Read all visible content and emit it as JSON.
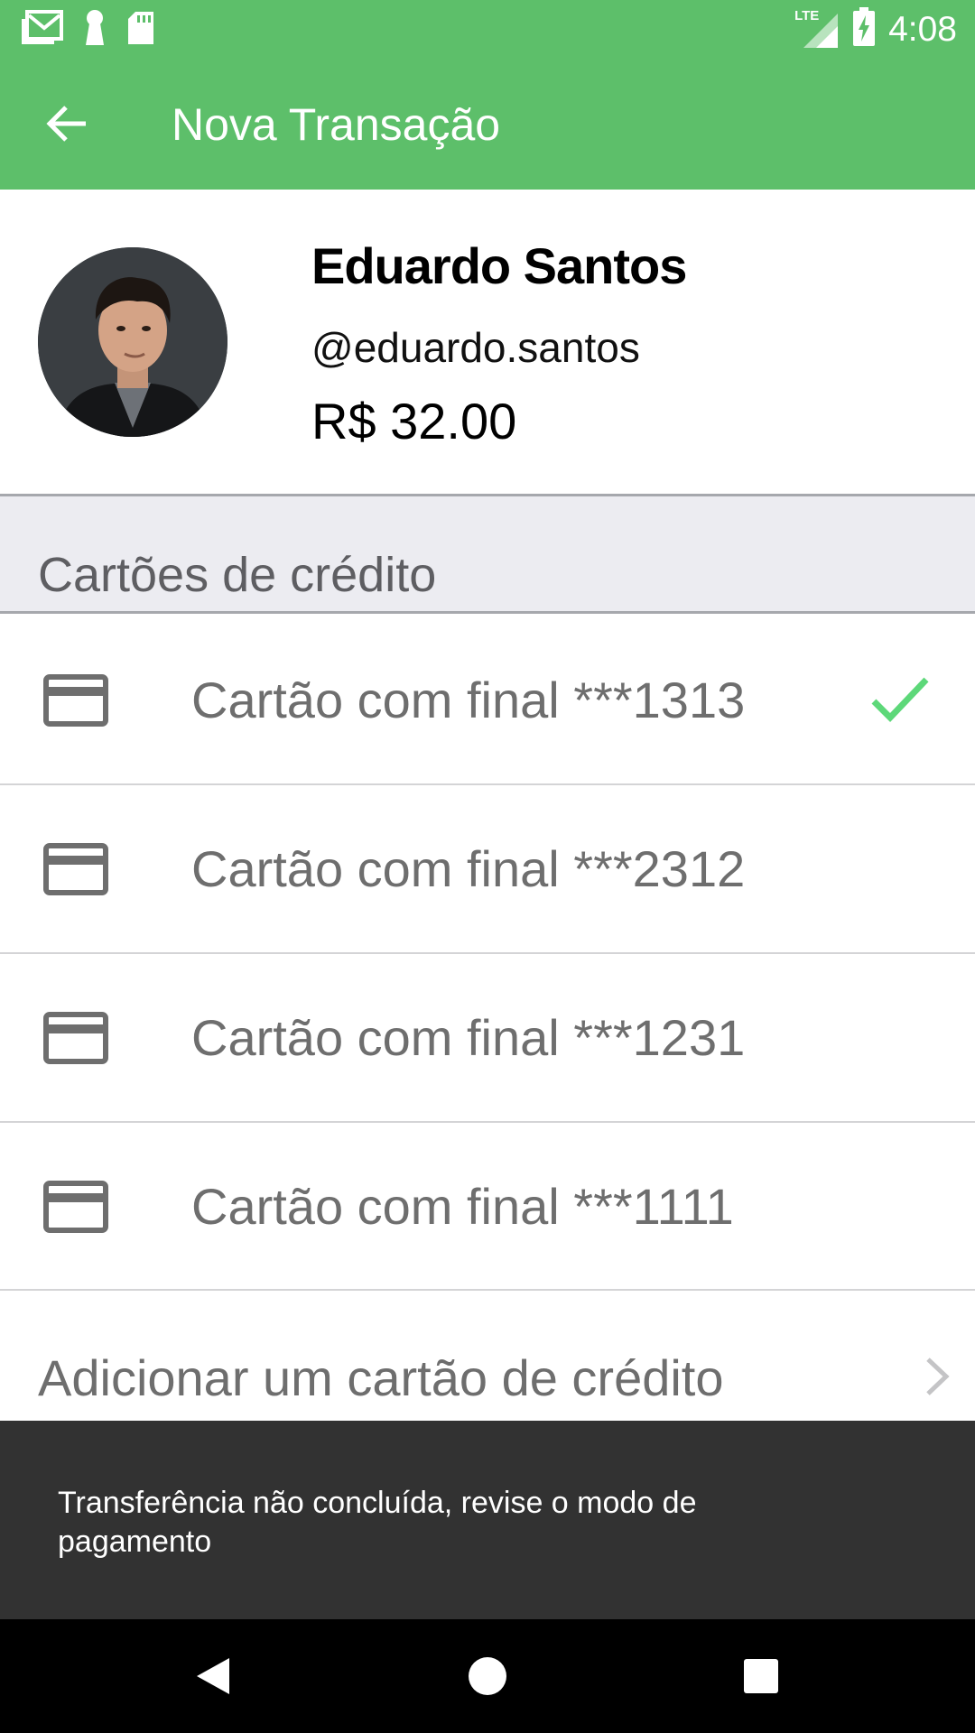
{
  "status_bar": {
    "time": "4:08",
    "network": "LTE",
    "icons": [
      "gmail-icon",
      "keyhole-icon",
      "sd-card-icon",
      "signal-icon",
      "battery-charging-icon"
    ]
  },
  "app_bar": {
    "title": "Nova Transação",
    "back_icon": "arrow-back-icon"
  },
  "profile": {
    "name": "Eduardo Santos",
    "handle": "@eduardo.santos",
    "amount": "R$ 32.00"
  },
  "cards_section": {
    "title": "Cartões de crédito",
    "cards": [
      {
        "label": "Cartão com final ***1313",
        "selected": true
      },
      {
        "label": "Cartão com final ***2312",
        "selected": false
      },
      {
        "label": "Cartão com final ***1231",
        "selected": false
      },
      {
        "label": "Cartão com final ***1111",
        "selected": false
      }
    ],
    "add_card_label": "Adicionar um cartão de crédito"
  },
  "snackbar": {
    "message": "Transferência não concluída, revise o modo de pagamento"
  },
  "colors": {
    "primary": "#5dbf6a",
    "check": "#5dd879",
    "snackbar": "#323232"
  }
}
